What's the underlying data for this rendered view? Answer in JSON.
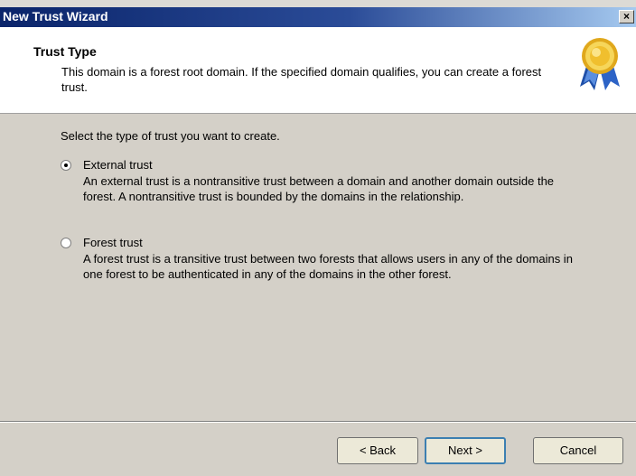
{
  "window": {
    "title": "New Trust Wizard",
    "close_glyph": "×"
  },
  "header": {
    "title": "Trust Type",
    "description": "This domain is a forest root domain. If the specified domain qualifies, you can create a forest trust.",
    "icon": "award-ribbon-icon"
  },
  "content": {
    "prompt": "Select the type of trust you want to create.",
    "options": [
      {
        "label": "External trust",
        "description": "An external trust is a nontransitive trust between a domain and another domain outside the forest. A nontransitive trust is bounded by the domains in the relationship.",
        "selected": true
      },
      {
        "label": "Forest trust",
        "description": "A forest trust is a transitive trust between two forests that allows users in any of the domains in one forest to be authenticated in any of the domains in the other forest.",
        "selected": false
      }
    ]
  },
  "buttons": {
    "back": "< Back",
    "next": "Next >",
    "cancel": "Cancel"
  },
  "colors": {
    "titlebar": "#0a246a",
    "dialog_bg": "#d4d0c8",
    "header_bg": "#ffffff",
    "default_button_border": "#3c7fb1"
  }
}
